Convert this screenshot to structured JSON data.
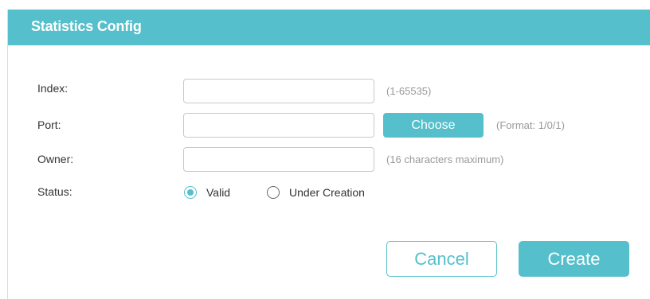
{
  "header": {
    "title": "Statistics Config"
  },
  "form": {
    "index": {
      "label": "Index:",
      "value": "",
      "hint": "(1-65535)"
    },
    "port": {
      "label": "Port:",
      "value": "",
      "choose_label": "Choose",
      "hint": "(Format: 1/0/1)"
    },
    "owner": {
      "label": "Owner:",
      "value": "",
      "hint": "(16 characters maximum)"
    },
    "status": {
      "label": "Status:",
      "options": [
        {
          "label": "Valid",
          "checked": true
        },
        {
          "label": "Under Creation",
          "checked": false
        }
      ]
    }
  },
  "actions": {
    "cancel_label": "Cancel",
    "create_label": "Create"
  },
  "colors": {
    "accent": "#55bfcb",
    "text": "#333333",
    "hint": "#999999",
    "border": "#c9c9c9"
  }
}
